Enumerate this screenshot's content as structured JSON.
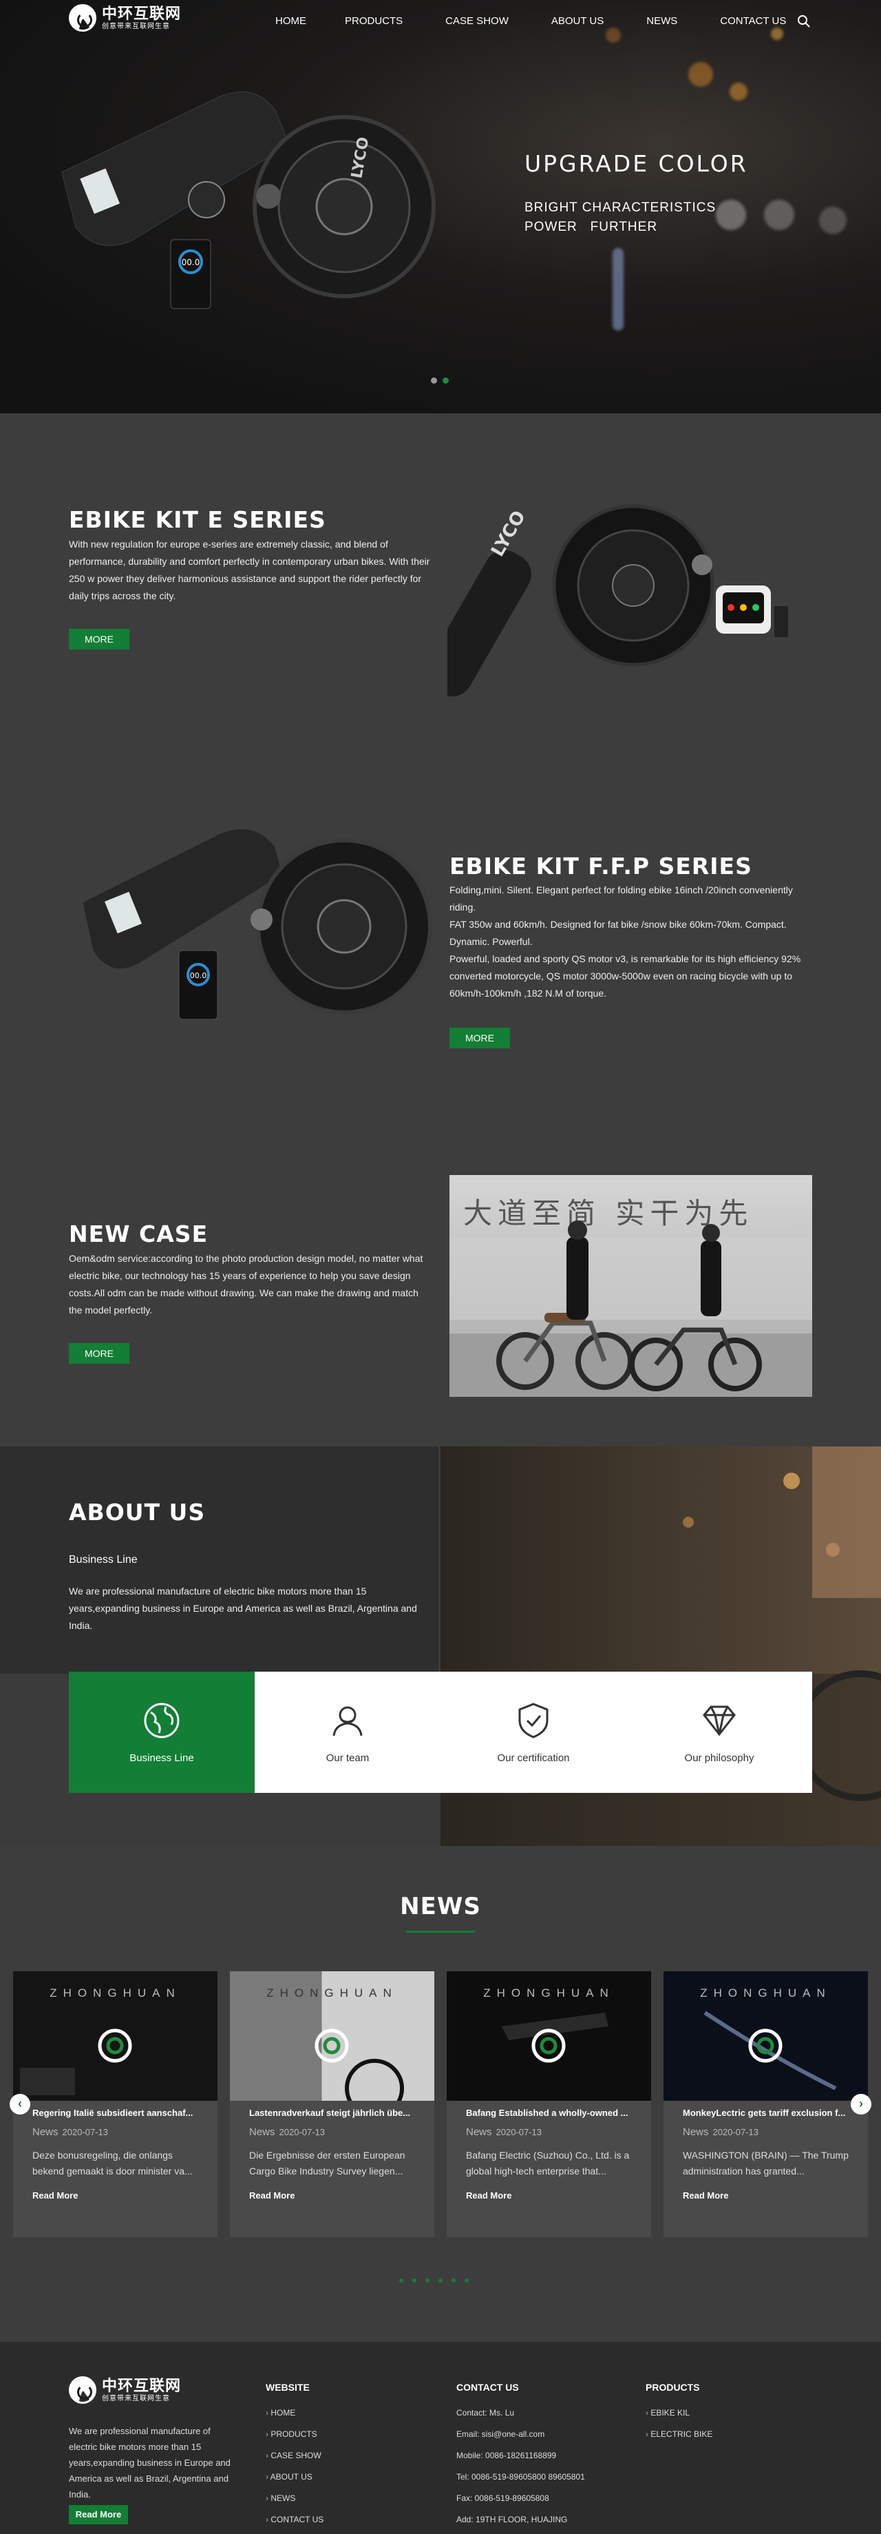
{
  "brand": {
    "name_cn": "中环互联网",
    "tagline_cn": "创意带来互联网生意"
  },
  "nav": [
    "HOME",
    "PRODUCTS",
    "CASE SHOW",
    "ABOUT US",
    "NEWS",
    "CONTACT US"
  ],
  "hero": {
    "headline": "UPGRADE COLOR",
    "sub1": "BRIGHT CHARACTERISTICS",
    "sub2": "POWER   FURTHER",
    "motor_label": "LYCO",
    "display_speed": "00.0",
    "slide_count": 2,
    "active_slide": 2
  },
  "sections": {
    "e_series": {
      "title": "EBIKE KIT E SERIES",
      "text": "With new regulation for europe e-series are extremely classic, and blend of performance, durability and comfort perfectly in contemporary urban bikes. With their 250 w power they deliver harmonious assistance and support the rider perfectly for daily trips across the city.",
      "more": "MORE"
    },
    "ffp_series": {
      "title": "EBIKE KIT F.F.P SERIES",
      "line1": "Folding,mini. Silent. Elegant perfect for folding ebike 16inch /20inch conveniently riding.",
      "line2": "FAT 350w and 60km/h. Designed for fat bike /snow bike 60km-70km. Compact. Dynamic. Powerful.",
      "line3": "Powerful, loaded and sporty QS motor v3, is remarkable for its high efficiency 92% converted motorcycle, QS motor 3000w-5000w even on racing bicycle with up to 60km/h-100km/h ,182 N.M of torque.",
      "more": "MORE"
    },
    "new_case": {
      "title": "NEW CASE",
      "text": "Oem&odm service:according to the photo production design model, no matter what electric bike, our technology has 15 years of experience to help you save design costs.All odm can be made without drawing. We can make the drawing and match the model perfectly.",
      "more": "MORE",
      "photo_banner": "大道至简 实干为先"
    }
  },
  "about": {
    "title": "ABOUT US",
    "subtitle": "Business Line",
    "text": "We are professional manufacture of electric bike motors more than 15 years,expanding business in Europe and America as well as Brazil, Argentina and India.",
    "tabs": [
      "Business Line",
      "Our team",
      "Our certification",
      "Our philosophy"
    ]
  },
  "news": {
    "title": "NEWS",
    "brand_mark": "ZHONGHUAN",
    "category": "News",
    "read_more": "Read More",
    "items": [
      {
        "title": "Regering Italië subsidieert aanschaf...",
        "date": "2020-07-13",
        "desc": "Deze bonusregeling, die onlangs bekend gemaakt is door minister va..."
      },
      {
        "title": "Lastenradverkauf steigt jährlich übe...",
        "date": "2020-07-13",
        "desc": "Die Ergebnisse der ersten European Cargo Bike Industry Survey liegen..."
      },
      {
        "title": "Bafang Established a wholly-owned ...",
        "date": "2020-07-13",
        "desc": "Bafang Electric (Suzhou) Co., Ltd. is a global high-tech enterprise that..."
      },
      {
        "title": "MonkeyLectric gets tariff exclusion f...",
        "date": "2020-07-13",
        "desc": "WASHINGTON (BRAIN) — The Trump administration has granted..."
      }
    ],
    "arrow_prev": "‹",
    "arrow_next": "›"
  },
  "footer": {
    "about": "We are professional manufacture of electric bike motors more than 15 years,expanding business in Europe and America as well as Brazil, Argentina and India.",
    "read_more": "Read More",
    "website": {
      "title": "WEBSITE",
      "links": [
        "HOME",
        "PRODUCTS",
        "CASE SHOW",
        "ABOUT US",
        "NEWS",
        "CONTACT US"
      ]
    },
    "contact": {
      "title": "CONTACT US",
      "lines": [
        "Contact: Ms. Lu",
        "Email: sisi@one-all.com",
        "Mobile: 0086-18261168899",
        "Tel: 0086-519-89605800  89605801",
        "Fax: 0086-519-89605808",
        "Add: 19TH FLOOR, HUAJING"
      ]
    },
    "products": {
      "title": "PRODUCTS",
      "links": [
        "EBIKE KIL",
        "ELECTRIC BIKE"
      ]
    }
  },
  "colors": {
    "accent": "#137e35",
    "page_bg": "#3d3d3d",
    "footer_bg": "#2b2b2b"
  }
}
